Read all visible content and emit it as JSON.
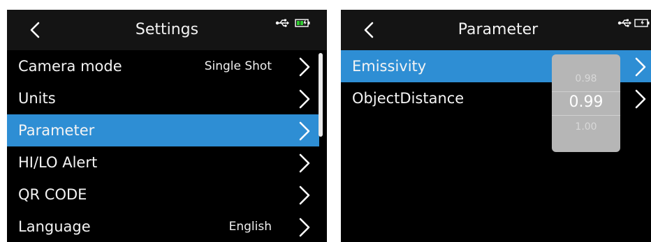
{
  "settings_screen": {
    "title": "Settings",
    "items": [
      {
        "label": "Camera mode",
        "value": "Single Shot"
      },
      {
        "label": "Units",
        "value": ""
      },
      {
        "label": "Parameter",
        "value": ""
      },
      {
        "label": "HI/LO Alert",
        "value": ""
      },
      {
        "label": "QR CODE",
        "value": ""
      },
      {
        "label": "Language",
        "value": "English"
      }
    ],
    "selected_item": "Parameter",
    "icons": [
      "back-icon",
      "usb-icon",
      "battery-icon",
      "chevron-right-icon"
    ]
  },
  "parameter_screen": {
    "title": "Parameter",
    "items": [
      {
        "label": "Emissivity"
      },
      {
        "label": "ObjectDistance"
      }
    ],
    "selected_item": "Emissivity",
    "picker": {
      "prev": "0.98",
      "current": "0.99",
      "next": "1.00"
    },
    "icons": [
      "back-icon",
      "usb-icon",
      "battery-icon",
      "chevron-right-icon"
    ]
  },
  "colors": {
    "background": "#000000",
    "highlight": "#2e8ed4",
    "header": "#141414",
    "picker": "#b6b6b6",
    "battery": "#33cc33"
  }
}
